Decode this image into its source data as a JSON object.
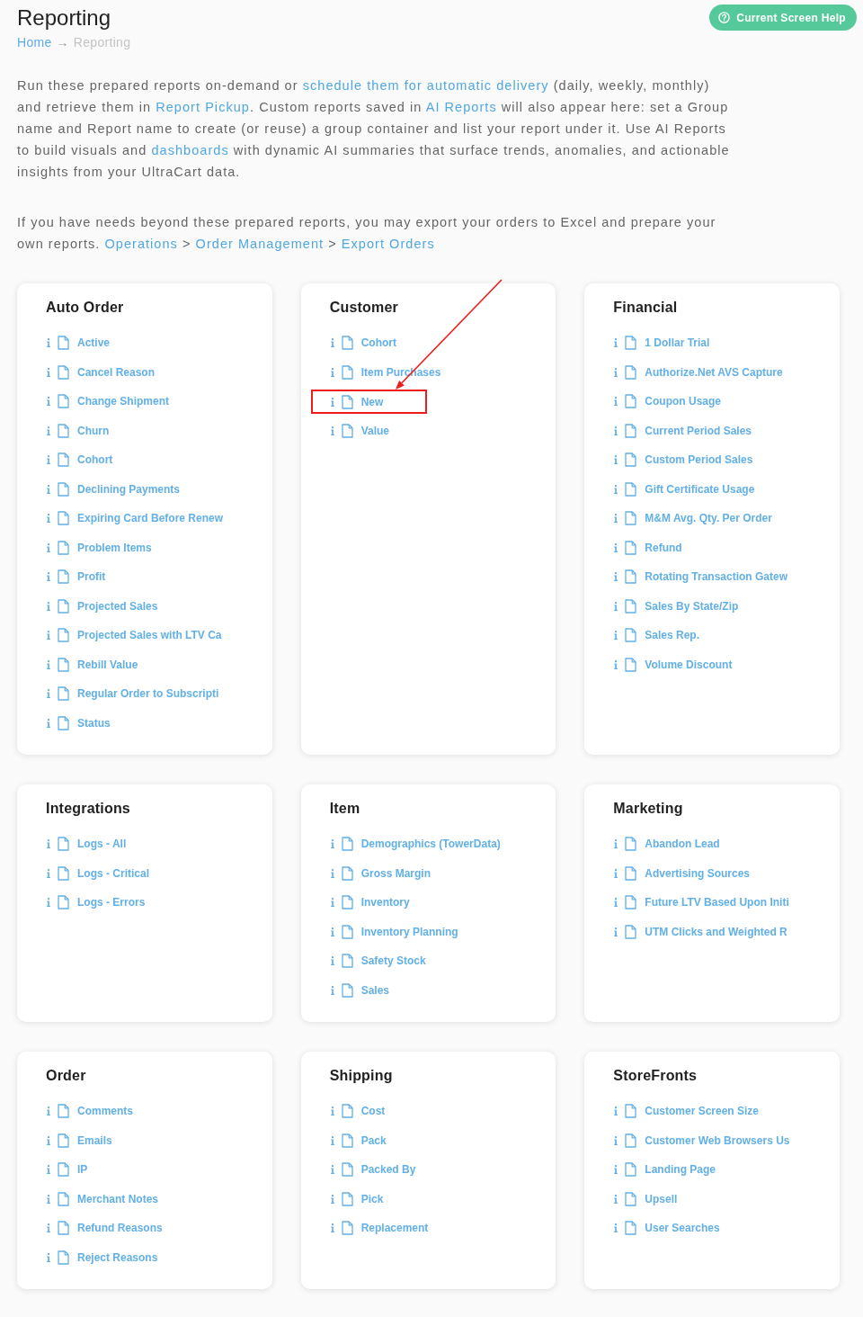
{
  "page": {
    "title": "Reporting"
  },
  "breadcrumb": [
    {
      "kind": "link",
      "label": "Home"
    },
    {
      "kind": "separator",
      "label": "→"
    },
    {
      "kind": "current",
      "label": "Reporting"
    }
  ],
  "help_button": {
    "label": "Current Screen Help"
  },
  "intro": [
    {
      "segments": [
        {
          "kind": "text",
          "text": "Run these prepared reports on-demand or "
        },
        {
          "kind": "link",
          "text": "schedule them for automatic delivery"
        },
        {
          "kind": "text",
          "text": " (daily, weekly, monthly) and retrieve them in "
        },
        {
          "kind": "link",
          "text": "Report Pickup"
        },
        {
          "kind": "text",
          "text": ". Custom reports saved in "
        },
        {
          "kind": "link",
          "text": "AI Reports"
        },
        {
          "kind": "text",
          "text": " will also appear here: set a Group name and Report name to create (or reuse) a group container and list your report under it. Use AI Reports to build visuals and "
        },
        {
          "kind": "link",
          "text": "dashboards"
        },
        {
          "kind": "text",
          "text": " with dynamic AI summaries that surface trends, anomalies, and actionable insights from your UltraCart data."
        }
      ]
    },
    {
      "segments": [
        {
          "kind": "text",
          "text": "If you have needs beyond these prepared reports, you may export your orders to Excel and prepare your own reports. "
        },
        {
          "kind": "link",
          "text": "Operations"
        },
        {
          "kind": "text",
          "text": " > "
        },
        {
          "kind": "link",
          "text": "Order Management"
        },
        {
          "kind": "text",
          "text": " > "
        },
        {
          "kind": "link",
          "text": "Export Orders"
        }
      ]
    }
  ],
  "groups": [
    {
      "title": "Auto Order",
      "reports": [
        {
          "label": "Active",
          "highlighted": false
        },
        {
          "label": "Cancel Reason",
          "highlighted": false
        },
        {
          "label": "Change Shipment",
          "highlighted": false
        },
        {
          "label": "Churn",
          "highlighted": false
        },
        {
          "label": "Cohort",
          "highlighted": false
        },
        {
          "label": "Declining Payments",
          "highlighted": false
        },
        {
          "label": "Expiring Card Before Renew",
          "highlighted": false
        },
        {
          "label": "Problem Items",
          "highlighted": false
        },
        {
          "label": "Profit",
          "highlighted": false
        },
        {
          "label": "Projected Sales",
          "highlighted": false
        },
        {
          "label": "Projected Sales with LTV Ca",
          "highlighted": false
        },
        {
          "label": "Rebill Value",
          "highlighted": false
        },
        {
          "label": "Regular Order to Subscripti",
          "highlighted": false
        },
        {
          "label": "Status",
          "highlighted": false
        }
      ]
    },
    {
      "title": "Customer",
      "reports": [
        {
          "label": "Cohort",
          "highlighted": false
        },
        {
          "label": "Item Purchases",
          "highlighted": false
        },
        {
          "label": "New",
          "highlighted": true
        },
        {
          "label": "Value",
          "highlighted": false
        }
      ]
    },
    {
      "title": "Financial",
      "reports": [
        {
          "label": "1 Dollar Trial",
          "highlighted": false
        },
        {
          "label": "Authorize.Net AVS Capture",
          "highlighted": false
        },
        {
          "label": "Coupon Usage",
          "highlighted": false
        },
        {
          "label": "Current Period Sales",
          "highlighted": false
        },
        {
          "label": "Custom Period Sales",
          "highlighted": false
        },
        {
          "label": "Gift Certificate Usage",
          "highlighted": false
        },
        {
          "label": "M&M Avg. Qty. Per Order",
          "highlighted": false
        },
        {
          "label": "Refund",
          "highlighted": false
        },
        {
          "label": "Rotating Transaction Gatew",
          "highlighted": false
        },
        {
          "label": "Sales By State/Zip",
          "highlighted": false
        },
        {
          "label": "Sales Rep.",
          "highlighted": false
        },
        {
          "label": "Volume Discount",
          "highlighted": false
        }
      ]
    },
    {
      "title": "Integrations",
      "reports": [
        {
          "label": "Logs - All",
          "highlighted": false
        },
        {
          "label": "Logs - Critical",
          "highlighted": false
        },
        {
          "label": "Logs - Errors",
          "highlighted": false
        }
      ]
    },
    {
      "title": "Item",
      "reports": [
        {
          "label": "Demographics (TowerData)",
          "highlighted": false
        },
        {
          "label": "Gross Margin",
          "highlighted": false
        },
        {
          "label": "Inventory",
          "highlighted": false
        },
        {
          "label": "Inventory Planning",
          "highlighted": false
        },
        {
          "label": "Safety Stock",
          "highlighted": false
        },
        {
          "label": "Sales",
          "highlighted": false
        }
      ]
    },
    {
      "title": "Marketing",
      "reports": [
        {
          "label": "Abandon Lead",
          "highlighted": false
        },
        {
          "label": "Advertising Sources",
          "highlighted": false
        },
        {
          "label": "Future LTV Based Upon Initi",
          "highlighted": false
        },
        {
          "label": "UTM Clicks and Weighted R",
          "highlighted": false
        }
      ]
    },
    {
      "title": "Order",
      "reports": [
        {
          "label": "Comments",
          "highlighted": false
        },
        {
          "label": "Emails",
          "highlighted": false
        },
        {
          "label": "IP",
          "highlighted": false
        },
        {
          "label": "Merchant Notes",
          "highlighted": false
        },
        {
          "label": "Refund Reasons",
          "highlighted": false
        },
        {
          "label": "Reject Reasons",
          "highlighted": false
        }
      ]
    },
    {
      "title": "Shipping",
      "reports": [
        {
          "label": "Cost",
          "highlighted": false
        },
        {
          "label": "Pack",
          "highlighted": false
        },
        {
          "label": "Packed By",
          "highlighted": false
        },
        {
          "label": "Pick",
          "highlighted": false
        },
        {
          "label": "Replacement",
          "highlighted": false
        }
      ]
    },
    {
      "title": "StoreFronts",
      "reports": [
        {
          "label": "Customer Screen Size",
          "highlighted": false
        },
        {
          "label": "Customer Web Browsers Us",
          "highlighted": false
        },
        {
          "label": "Landing Page",
          "highlighted": false
        },
        {
          "label": "Upsell",
          "highlighted": false
        },
        {
          "label": "User Searches",
          "highlighted": false
        }
      ]
    }
  ]
}
